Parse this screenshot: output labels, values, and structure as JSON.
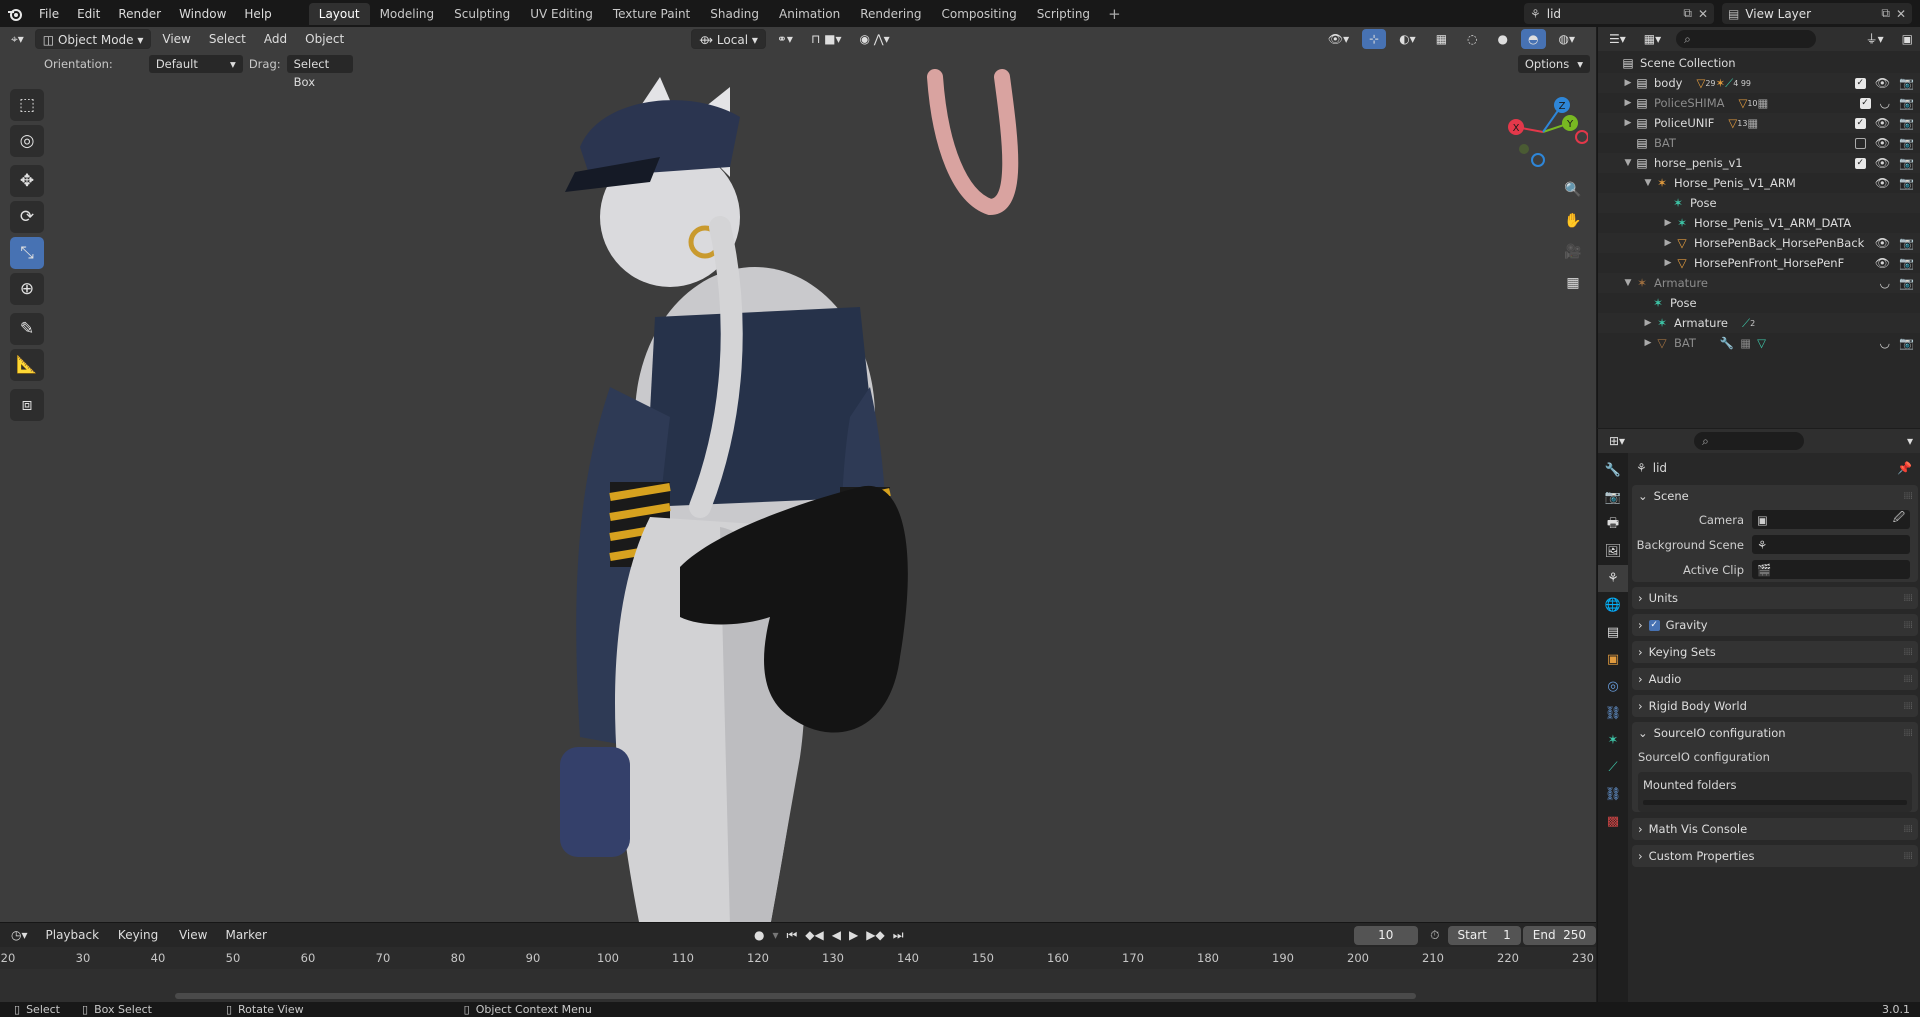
{
  "topbar": {
    "menus": [
      "File",
      "Edit",
      "Render",
      "Window",
      "Help"
    ],
    "workspaces": [
      "Layout",
      "Modeling",
      "Sculpting",
      "UV Editing",
      "Texture Paint",
      "Shading",
      "Animation",
      "Rendering",
      "Compositing",
      "Scripting"
    ],
    "active_workspace": "Layout",
    "add_tab": "+",
    "scene_name": "lid",
    "view_layer": "View Layer"
  },
  "viewport": {
    "mode": "Object Mode",
    "menus": [
      "View",
      "Select",
      "Add",
      "Object"
    ],
    "transform_orientation": "Local",
    "orientation_label": "Orientation:",
    "orientation_value": "Default",
    "drag_label": "Drag:",
    "drag_value": "Select Box",
    "options_label": "Options",
    "gizmo_axes": {
      "x": "X",
      "y": "Y",
      "z": "Z"
    }
  },
  "timeline": {
    "menus": [
      "Playback",
      "Keying",
      "View",
      "Marker"
    ],
    "current_frame": "10",
    "start_label": "Start",
    "start_value": "1",
    "end_label": "End",
    "end_value": "250",
    "ticks": [
      "20",
      "30",
      "40",
      "50",
      "60",
      "70",
      "80",
      "90",
      "100",
      "110",
      "120",
      "130",
      "140",
      "150",
      "160",
      "170",
      "180",
      "190",
      "200",
      "210",
      "220",
      "230"
    ]
  },
  "statusbar": {
    "select": "Select",
    "box_select": "Box Select",
    "rotate_view": "Rotate View",
    "context_menu": "Object Context Menu",
    "version": "3.0.1"
  },
  "outliner": {
    "root": "Scene Collection",
    "rows": [
      {
        "name": "body",
        "badge1": "29",
        "badge2": "4 99"
      },
      {
        "name": "PoliceSHIMA",
        "badge1": "10"
      },
      {
        "name": "PoliceUNIF",
        "badge1": "13"
      },
      {
        "name": "BAT"
      },
      {
        "name": "horse_penis_v1"
      },
      {
        "name": "Horse_Penis_V1_ARM"
      },
      {
        "name": "Pose"
      },
      {
        "name": "Horse_Penis_V1_ARM_DATA"
      },
      {
        "name": "HorsePenBack_HorsePenBack"
      },
      {
        "name": "HorsePenFront_HorsePenFront"
      },
      {
        "name": "Armature"
      },
      {
        "name": "Pose"
      },
      {
        "name": "Armature",
        "badge1": "2"
      },
      {
        "name": "BAT"
      }
    ]
  },
  "properties": {
    "scene_name": "lid",
    "scene_panel": "Scene",
    "camera_label": "Camera",
    "background_scene_label": "Background Scene",
    "active_clip_label": "Active Clip",
    "panels": [
      "Units",
      "Gravity",
      "Keying Sets",
      "Audio",
      "Rigid Body World"
    ],
    "sourceio_panel": "SourceIO configuration",
    "sourceio_sub": "SourceIO configuration",
    "mounted_folders": "Mounted folders",
    "tail_panels": [
      "Math Vis Console",
      "Custom Properties"
    ]
  },
  "colors": {
    "accent": "#4772b3",
    "axis_x": "#e3384a",
    "axis_y": "#78b822",
    "axis_z": "#2e86d8"
  }
}
